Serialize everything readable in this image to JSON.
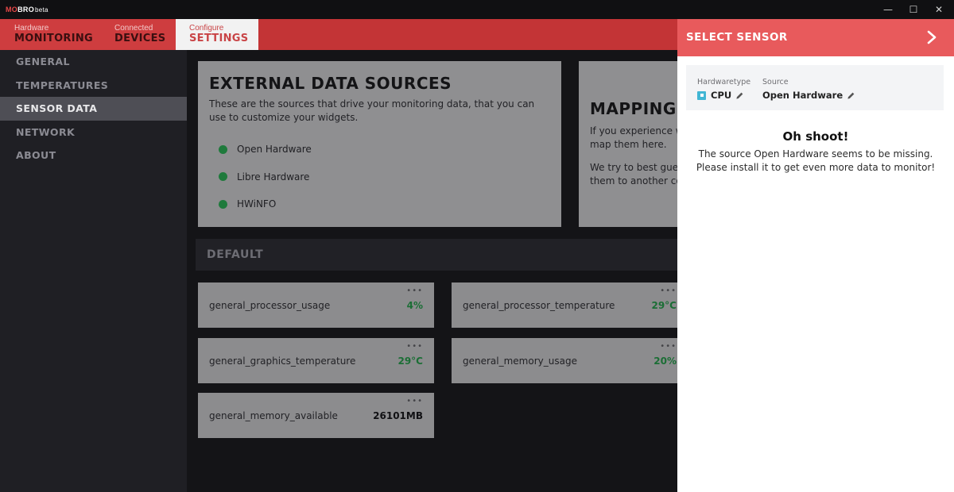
{
  "app": {
    "logo_mo": "MO",
    "logo_bro": "BRO",
    "logo_beta": "beta"
  },
  "window_controls": {
    "minimize": "—",
    "maximize": "☐",
    "close": "✕"
  },
  "tabs": [
    {
      "small": "Hardware",
      "big": "MONITORING"
    },
    {
      "small": "Connected",
      "big": "DEVICES"
    },
    {
      "small": "Configure",
      "big": "SETTINGS"
    }
  ],
  "sidebar": {
    "items": [
      {
        "label": "GENERAL"
      },
      {
        "label": "TEMPERATURES"
      },
      {
        "label": "SENSOR DATA"
      },
      {
        "label": "NETWORK"
      },
      {
        "label": "ABOUT"
      }
    ]
  },
  "external": {
    "title": "EXTERNAL DATA SOURCES",
    "description": "These are the sources that drive your monitoring data, that you can use to customize your widgets.",
    "sources": [
      {
        "name": "Open Hardware"
      },
      {
        "name": "Libre Hardware"
      },
      {
        "name": "HWiNFO"
      }
    ]
  },
  "mapping": {
    "title": "MAPPING",
    "text1": "If you experience wr",
    "text1b": "map them here.",
    "text2": "We try to best guess",
    "text2b": "them to another cor"
  },
  "default_section": {
    "label": "DEFAULT"
  },
  "sensors": [
    {
      "name": "general_processor_usage",
      "value": "4%",
      "menu": "•••"
    },
    {
      "name": "general_processor_temperature",
      "value": "29°C",
      "menu": "•••"
    },
    {
      "name": "general_graphics_temperature",
      "value": "29°C",
      "menu": "•••"
    },
    {
      "name": "general_memory_usage",
      "value": "20%",
      "menu": "•••"
    },
    {
      "name": "general_memory_available",
      "value": "26101MB",
      "menu": "•••"
    }
  ],
  "panel": {
    "title": "SELECT SENSOR",
    "hardwaretype_label": "Hardwaretype",
    "hardwaretype_value": "CPU",
    "source_label": "Source",
    "source_value": "Open Hardware",
    "heading": "Oh shoot!",
    "message": "The source Open Hardware seems to be missing. Please install it to get even more data to monitor!"
  }
}
